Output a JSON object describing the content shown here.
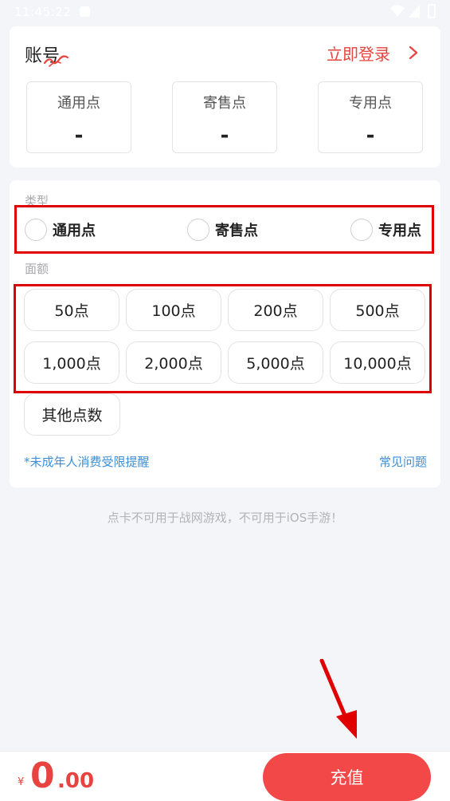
{
  "status_bar": {
    "time": "11:45:22"
  },
  "account": {
    "title": "账号",
    "login_label": "立即登录",
    "points": [
      {
        "label": "通用点",
        "value": "-"
      },
      {
        "label": "寄售点",
        "value": "-"
      },
      {
        "label": "专用点",
        "value": "-"
      }
    ]
  },
  "recharge": {
    "type_label": "类型",
    "types": [
      {
        "label": "通用点"
      },
      {
        "label": "寄售点"
      },
      {
        "label": "专用点"
      }
    ],
    "amount_label": "面额",
    "amounts": [
      "50点",
      "100点",
      "200点",
      "500点",
      "1,000点",
      "2,000点",
      "5,000点",
      "10,000点"
    ],
    "other_amount": "其他点数",
    "minor_notice": "*未成年人消费受限提醒",
    "faq": "常见问题"
  },
  "notice": "点卡不可用于战网游戏，不可用于iOS手游！",
  "bottom": {
    "currency": "¥",
    "price_int": "0",
    "price_dec": ".00",
    "recharge_button": "充值"
  },
  "colors": {
    "accent": "#e8433e",
    "button": "#f24848",
    "link": "#3d8fd6",
    "annotation": "#e00000"
  }
}
